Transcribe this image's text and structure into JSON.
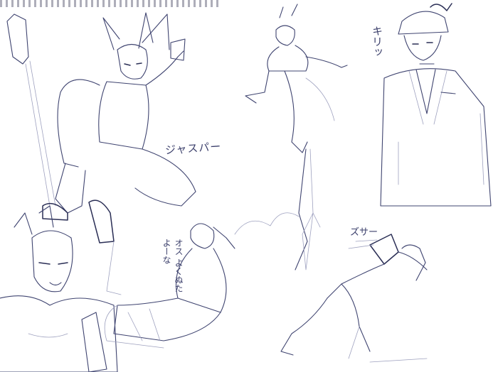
{
  "sketch_notes": {
    "jasper": "ジャスパー",
    "kiri": "キリッ",
    "osu": "オス よくぬたよーな",
    "zuza": "ズサー"
  },
  "colors": {
    "paper": "#ffffff",
    "pencil": "#3f4470",
    "light_pencil": "#9ea1bf"
  }
}
